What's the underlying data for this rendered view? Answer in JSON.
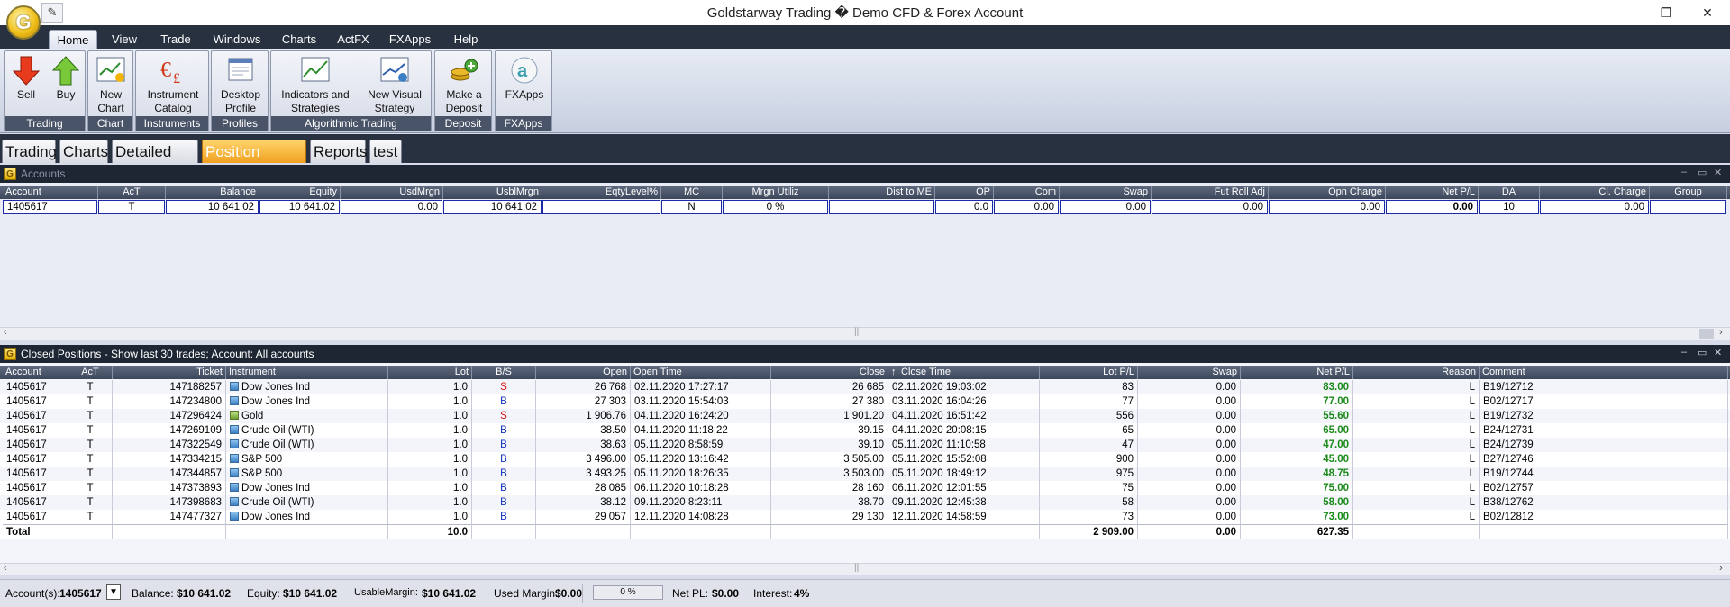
{
  "window": {
    "title": "Goldstarway Trading � Demo CFD & Forex Account"
  },
  "menu": [
    "Home",
    "View",
    "Trade",
    "Windows",
    "Charts",
    "ActFX",
    "FXApps",
    "Help"
  ],
  "ribbon": {
    "groups": [
      {
        "caption": "Trading",
        "buttons": [
          "Sell",
          "Buy"
        ]
      },
      {
        "caption": "Chart",
        "buttons": [
          "New Chart"
        ]
      },
      {
        "caption": "Instruments",
        "buttons": [
          "Instrument Catalog"
        ]
      },
      {
        "caption": "Profiles",
        "buttons": [
          "Desktop Profile"
        ]
      },
      {
        "caption": "Algorithmic Trading",
        "buttons": [
          "Indicators and Strategies",
          "New Visual Strategy"
        ]
      },
      {
        "caption": "Deposit",
        "buttons": [
          "Make a Deposit"
        ]
      },
      {
        "caption": "FXApps",
        "buttons": [
          "FXApps"
        ]
      }
    ]
  },
  "tabs": [
    "Trading",
    "Charts",
    "Detailed Info",
    "Position History",
    "Reports",
    "test"
  ],
  "accounts": {
    "title": "Accounts",
    "columns": [
      "Account",
      "AcT",
      "Balance",
      "Equity",
      "UsdMrgn",
      "UsblMrgn",
      "EqtyLevel%",
      "MC",
      "Mrgn Utiliz",
      "Dist to ME",
      "OP",
      "Com",
      "Swap",
      "Fut Roll Adj",
      "Opn Charge",
      "Net P/L",
      "DA",
      "Cl. Charge",
      "Group"
    ],
    "row": [
      "1405617",
      "T",
      "10 641.02",
      "10 641.02",
      "0.00",
      "10 641.02",
      "",
      "N",
      "0 %",
      "",
      "0.0",
      "0.00",
      "0.00",
      "0.00",
      "0.00",
      "0.00",
      "10",
      "0.00",
      ""
    ]
  },
  "closed": {
    "title": "Closed Positions - Show last 30 trades; Account: All accounts",
    "columns": [
      "Account",
      "AcT",
      "Ticket",
      "Instrument",
      "Lot",
      "B/S",
      "Open",
      "Open Time",
      "Close",
      "Close Time",
      "Lot P/L",
      "Swap",
      "Net P/L",
      "Reason",
      "Comment"
    ],
    "rows": [
      [
        "1405617",
        "T",
        "147188257",
        "Dow Jones Ind",
        "1.0",
        "S",
        "26 768",
        "02.11.2020 17:27:17",
        "26 685",
        "02.11.2020 19:03:02",
        "83",
        "0.00",
        "83.00",
        "L",
        "B19/12712"
      ],
      [
        "1405617",
        "T",
        "147234800",
        "Dow Jones Ind",
        "1.0",
        "B",
        "27 303",
        "03.11.2020 15:54:03",
        "27 380",
        "03.11.2020 16:04:26",
        "77",
        "0.00",
        "77.00",
        "L",
        "B02/12717"
      ],
      [
        "1405617",
        "T",
        "147296424",
        "Gold",
        "1.0",
        "S",
        "1 906.76",
        "04.11.2020 16:24:20",
        "1 901.20",
        "04.11.2020 16:51:42",
        "556",
        "0.00",
        "55.60",
        "L",
        "B19/12732"
      ],
      [
        "1405617",
        "T",
        "147269109",
        "Crude Oil (WTI)",
        "1.0",
        "B",
        "38.50",
        "04.11.2020 11:18:22",
        "39.15",
        "04.11.2020 20:08:15",
        "65",
        "0.00",
        "65.00",
        "L",
        "B24/12731"
      ],
      [
        "1405617",
        "T",
        "147322549",
        "Crude Oil (WTI)",
        "1.0",
        "B",
        "38.63",
        "05.11.2020 8:58:59",
        "39.10",
        "05.11.2020 11:10:58",
        "47",
        "0.00",
        "47.00",
        "L",
        "B24/12739"
      ],
      [
        "1405617",
        "T",
        "147334215",
        "S&P 500",
        "1.0",
        "B",
        "3 496.00",
        "05.11.2020 13:16:42",
        "3 505.00",
        "05.11.2020 15:52:08",
        "900",
        "0.00",
        "45.00",
        "L",
        "B27/12746"
      ],
      [
        "1405617",
        "T",
        "147344857",
        "S&P 500",
        "1.0",
        "B",
        "3 493.25",
        "05.11.2020 18:26:35",
        "3 503.00",
        "05.11.2020 18:49:12",
        "975",
        "0.00",
        "48.75",
        "L",
        "B19/12744"
      ],
      [
        "1405617",
        "T",
        "147373893",
        "Dow Jones Ind",
        "1.0",
        "B",
        "28 085",
        "06.11.2020 10:18:28",
        "28 160",
        "06.11.2020 12:01:55",
        "75",
        "0.00",
        "75.00",
        "L",
        "B02/12757"
      ],
      [
        "1405617",
        "T",
        "147398683",
        "Crude Oil (WTI)",
        "1.0",
        "B",
        "38.12",
        "09.11.2020 8:23:11",
        "38.70",
        "09.11.2020 12:45:38",
        "58",
        "0.00",
        "58.00",
        "L",
        "B38/12762"
      ],
      [
        "1405617",
        "T",
        "147477327",
        "Dow Jones Ind",
        "1.0",
        "B",
        "29 057",
        "12.11.2020 14:08:28",
        "29 130",
        "12.11.2020 14:58:59",
        "73",
        "0.00",
        "73.00",
        "L",
        "B02/12812"
      ]
    ],
    "total": {
      "label": "Total",
      "lot": "10.0",
      "lot_pl": "2 909.00",
      "swap": "0.00",
      "net_pl": "627.35"
    }
  },
  "status": {
    "account_label": "Account(s):",
    "account": "1405617",
    "balance_label": "Balance:",
    "balance": "$10 641.02",
    "equity_label": "Equity:",
    "equity": "$10 641.02",
    "usable_label": "UsableMargin:",
    "usable": "$10 641.02",
    "used_label": "Used Margin:",
    "used": "$0.00",
    "progress": "0 %",
    "netpl_label": "Net PL:",
    "netpl": "$0.00",
    "interest_label": "Interest:",
    "interest": "4%"
  }
}
